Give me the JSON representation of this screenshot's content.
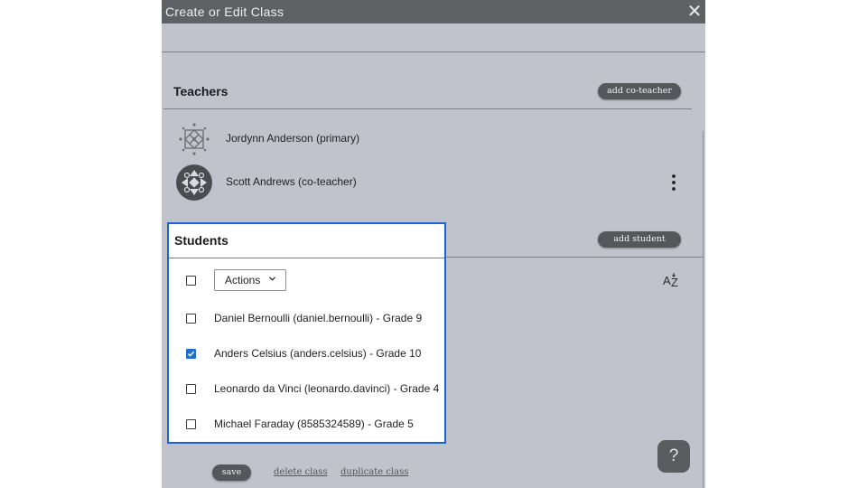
{
  "dialog": {
    "title": "Create or Edit Class",
    "close_icon": "close-icon"
  },
  "teachers": {
    "title": "Teachers",
    "add_button": "add co-teacher",
    "items": [
      {
        "name": "Jordynn Anderson (primary)",
        "icon": "pattern-avatar-icon"
      },
      {
        "name": "Scott Andrews (co-teacher)",
        "icon": "pattern-avatar-icon"
      }
    ],
    "menu_icon": "more-vertical-icon"
  },
  "students": {
    "title": "Students",
    "add_button": "add student",
    "actions_label": "Actions",
    "actions_icon": "chevron-down-icon",
    "sort_icon": "sort-alpha-icon",
    "items": [
      {
        "label": "Daniel Bernoulli (daniel.bernoulli) - Grade 9",
        "checked": false
      },
      {
        "label": "Anders Celsius (anders.celsius) - Grade 10",
        "checked": true
      },
      {
        "label": "Leonardo da Vinci (leonardo.davinci) - Grade 4",
        "checked": false
      },
      {
        "label": "Michael Faraday (8585324589) - Grade 5",
        "checked": false
      }
    ]
  },
  "footer": {
    "save": "save",
    "delete": "delete class",
    "duplicate": "duplicate class"
  },
  "help": {
    "label": "?",
    "icon": "help-icon"
  },
  "colors": {
    "dialog_bg": "#c0c3cc",
    "titlebar_bg": "#5f6165",
    "button_bg": "#55575b",
    "highlight_border": "#1a64d6",
    "checkbox_checked": "#1f6fd1"
  }
}
